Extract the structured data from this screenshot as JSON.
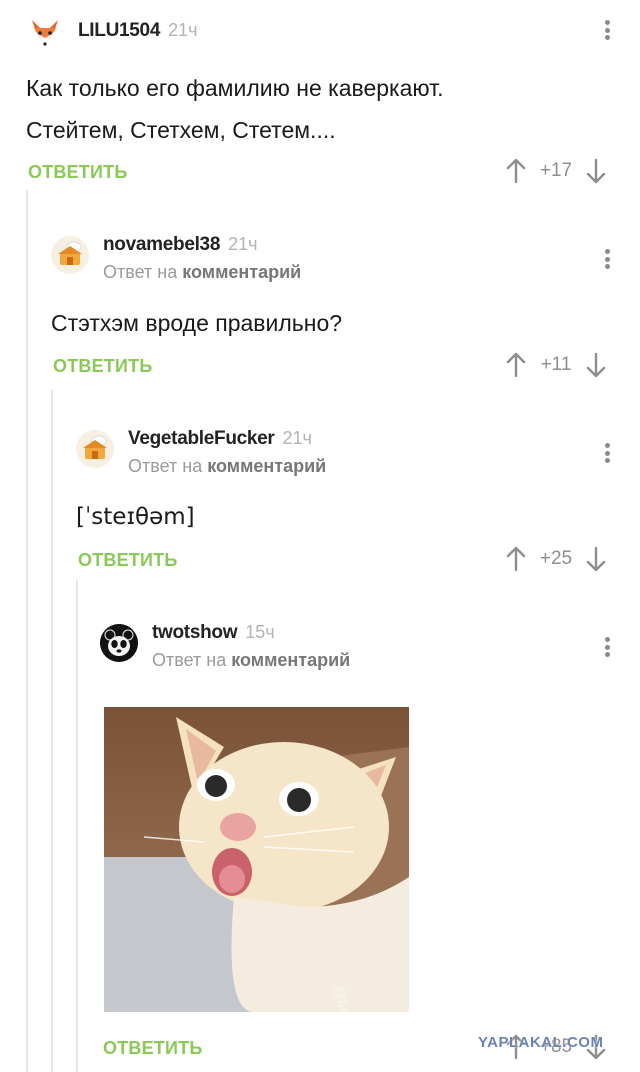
{
  "comments": [
    {
      "username": "LILU1504",
      "time": "21ч",
      "text_lines": [
        "Как только его фамилию не каверкают.",
        "Стейтем, Стетхем, Стетем...."
      ],
      "reply_label": "ОТВЕТИТЬ",
      "score": "+17",
      "avatar_icon": "fox-avatar-icon"
    },
    {
      "username": "novamebel38",
      "time": "21ч",
      "reply_to_prefix": "Ответ на",
      "reply_to_target": "комментарий",
      "text": "Стэтхэм вроде правильно?",
      "reply_label": "ОТВЕТИТЬ",
      "score": "+11",
      "avatar_icon": "default-avatar-icon"
    },
    {
      "username": "VegetableFucker",
      "time": "21ч",
      "reply_to_prefix": "Ответ на",
      "reply_to_target": "комментарий",
      "text": "[ˈsteɪθəm]",
      "reply_label": "ОТВЕТИТЬ",
      "score": "+25",
      "avatar_icon": "default-avatar-icon"
    },
    {
      "username": "twotshow",
      "time": "15ч",
      "reply_to_prefix": "Ответ на",
      "reply_to_target": "комментарий",
      "image": "coughing-cat-image",
      "reply_label": "ОТВЕТИТЬ",
      "score": "+85",
      "avatar_icon": "panda-avatar-icon"
    }
  ],
  "watermark": "YAPLAKAL.COM",
  "colors": {
    "accent_green": "#8ac858",
    "muted_gray": "#8e8e8e",
    "thread_line": "#e6e6e6"
  }
}
